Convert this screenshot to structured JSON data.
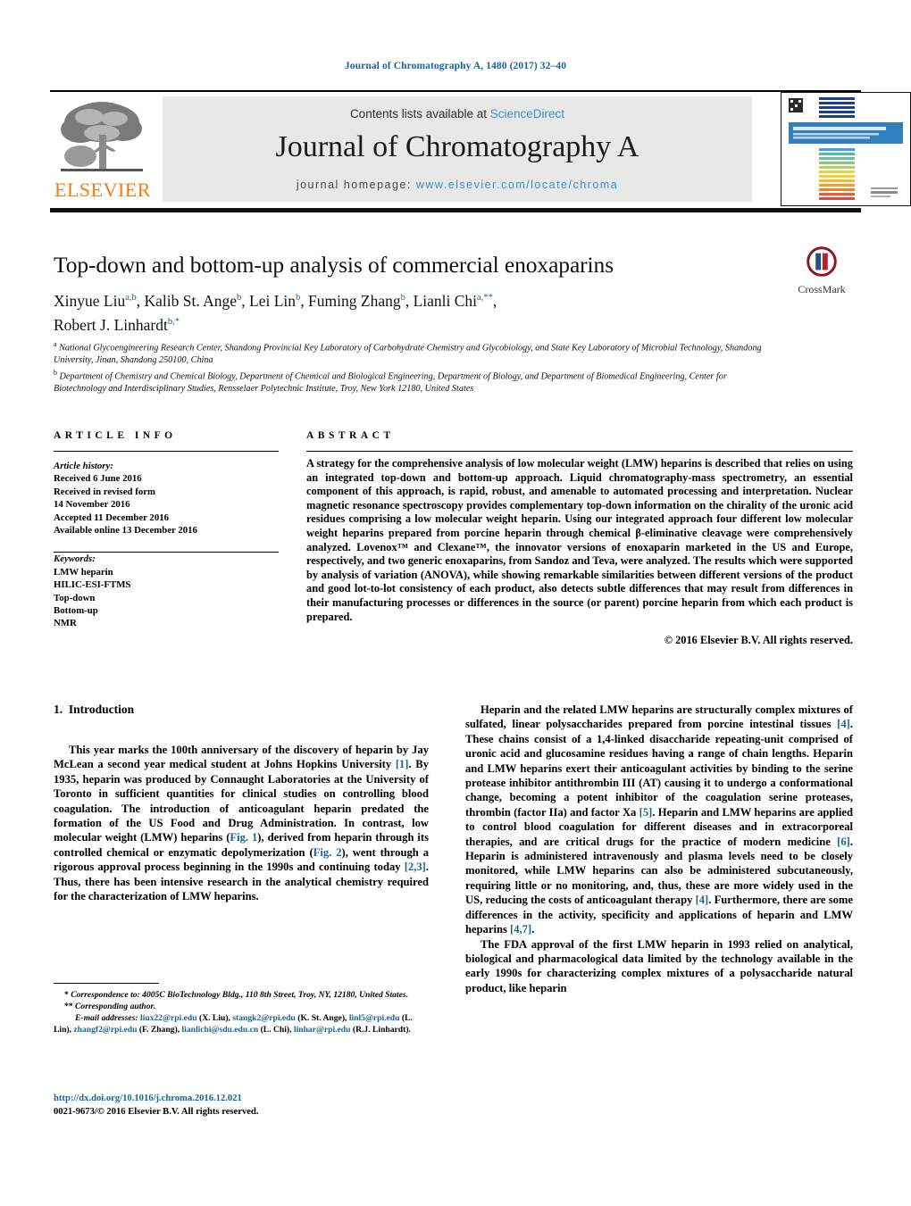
{
  "running_head": "Journal of Chromatography A, 1480 (2017) 32–40",
  "masthead": {
    "publisher": "ELSEVIER",
    "contents_prefix": "Contents lists available at ",
    "contents_link": "ScienceDirect",
    "journal_title": "Journal of Chromatography A",
    "homepage_label": "journal homepage: ",
    "homepage_url": "www.elsevier.com/locate/chroma",
    "cover_title": "JOURNAL OF CHROMATOGRAPHY A",
    "cover_subtitle": "INCLUDING ELECTROPHORESIS AND OTHER SEPARATION METHODS"
  },
  "article": {
    "title": "Top-down and bottom-up analysis of commercial enoxaparins",
    "crossmark_label": "CrossMark",
    "authors_line1_parts": [
      {
        "name": "Xinyue Liu",
        "sup": "a,b"
      },
      {
        "name": "Kalib St. Ange",
        "sup": "b"
      },
      {
        "name": "Lei Lin",
        "sup": "b"
      },
      {
        "name": "Fuming Zhang",
        "sup": "b"
      },
      {
        "name": "Lianli Chi",
        "sup": "a,**"
      }
    ],
    "authors_line2_parts": [
      {
        "name": "Robert J. Linhardt",
        "sup": "b,*"
      }
    ],
    "affiliations": [
      {
        "marker": "a",
        "text": "National Glycoengineering Research Center, Shandong Provincial Key Laboratory of Carbohydrate Chemistry and Glycobiology, and State Key Laboratory of Microbial Technology, Shandong University, Jinan, Shandong 250100, China"
      },
      {
        "marker": "b",
        "text": "Department of Chemistry and Chemical Biology, Department of Chemical and Biological Engineering, Department of Biology, and Department of Biomedical Engineering, Center for Biotechnology and Interdisciplinary Studies, Rensselaer Polytechnic Institute, Troy, New York 12180, United States"
      }
    ]
  },
  "article_info": {
    "label": "ARTICLE INFO",
    "history_heading": "Article history:",
    "history": [
      "Received 6 June 2016",
      "Received in revised form",
      "14 November 2016",
      "Accepted 11 December 2016",
      "Available online 13 December 2016"
    ],
    "keywords_heading": "Keywords:",
    "keywords": [
      "LMW heparin",
      "HILIC-ESI-FTMS",
      "Top-down",
      "Bottom-up",
      "NMR"
    ]
  },
  "abstract": {
    "label": "ABSTRACT",
    "text": "A strategy for the comprehensive analysis of low molecular weight (LMW) heparins is described that relies on using an integrated top-down and bottom-up approach. Liquid chromatography-mass spectrometry, an essential component of this approach, is rapid, robust, and amenable to automated processing and interpretation. Nuclear magnetic resonance spectroscopy provides complementary top-down information on the chirality of the uronic acid residues comprising a low molecular weight heparin. Using our integrated approach four different low molecular weight heparins prepared from porcine heparin through chemical β-eliminative cleavage were comprehensively analyzed. Lovenox™ and Clexane™, the innovator versions of enoxaparin marketed in the US and Europe, respectively, and two generic enoxaparins, from Sandoz and Teva, were analyzed. The results which were supported by analysis of variation (ANOVA), while showing remarkable similarities between different versions of the product and good lot-to-lot consistency of each product, also detects subtle differences that may result from differences in their manufacturing processes or differences in the source (or parent) porcine heparin from which each product is prepared.",
    "copyright": "© 2016 Elsevier B.V. All rights reserved."
  },
  "body": {
    "section_number": "1.",
    "section_title": "Introduction",
    "left_paragraph_1_a": "This year marks the 100th anniversary of the discovery of heparin by Jay McLean a second year medical student at Johns Hopkins University ",
    "left_ref_1": "[1]",
    "left_paragraph_1_b": ". By 1935, heparin was produced by Connaught Laboratories at the University of Toronto in sufficient quantities for clinical studies on controlling blood coagulation. The introduction of anticoagulant heparin predated the formation of the US Food and Drug Administration. In contrast, low molecular weight (LMW) heparins (",
    "left_ref_fig1": "Fig. 1",
    "left_paragraph_1_c": "), derived from heparin through its controlled chemical or enzymatic depolymerization (",
    "left_ref_fig2": "Fig. 2",
    "left_paragraph_1_d": "), went through a rigorous approval process beginning in the 1990s and continuing today ",
    "left_ref_23": "[2,3]",
    "left_paragraph_1_e": ". Thus, there has been intensive research in the analytical chemistry required for the characterization of LMW heparins.",
    "right_paragraph_1_a": "Heparin and the related LMW heparins are structurally complex mixtures of sulfated, linear polysaccharides prepared from porcine intestinal tissues ",
    "right_ref_4": "[4]",
    "right_paragraph_1_b": ". These chains consist of a 1,4-linked disaccharide repeating-unit comprised of uronic acid and glucosamine residues having a range of chain lengths. Heparin and LMW heparins exert their anticoagulant activities by binding to the serine protease inhibitor antithrombin III (AT) causing it to undergo a conformational change, becoming a potent inhibitor of the coagulation serine proteases, thrombin (factor IIa) and factor Xa ",
    "right_ref_5": "[5]",
    "right_paragraph_1_c": ". Heparin and LMW heparins are applied to control blood coagulation for different diseases and in extracorporeal therapies, and are critical drugs for the practice of modern medicine ",
    "right_ref_6": "[6]",
    "right_paragraph_1_d": ". Heparin is administered intravenously and plasma levels need to be closely monitored, while LMW heparins can also be administered subcutaneously, requiring little or no monitoring, and, thus, these are more widely used in the US, reducing the costs of anticoagulant therapy ",
    "right_ref_4b": "[4]",
    "right_paragraph_1_e": ". Furthermore, there are some differences in the activity, specificity and applications of heparin and LMW heparins ",
    "right_ref_47": "[4,7]",
    "right_paragraph_1_f": ".",
    "right_paragraph_2": "The FDA approval of the first LMW heparin in 1993 relied on analytical, biological and pharmacological data limited by the technology available in the early 1990s for characterizing complex mixtures of a polysaccharide natural product, like heparin"
  },
  "footnotes": {
    "correspondence_marker": "*",
    "correspondence_text": "Correspondence to: 4005C BioTechnology Bldg., 110 8th Street, Troy, NY, 12180, United States.",
    "corresponding_marker": "**",
    "corresponding_text": "Corresponding author.",
    "email_label": "E-mail addresses:",
    "emails": [
      {
        "address": "liux22@rpi.edu",
        "person": "(X. Liu)"
      },
      {
        "address": "stangk2@rpi.edu",
        "person": "(K. St. Ange)"
      },
      {
        "address": "linl5@rpi.edu",
        "person": "(L. Lin)"
      },
      {
        "address": "zhangf2@rpi.edu",
        "person": "(F. Zhang)"
      },
      {
        "address": "lianlichi@sdu.edu.cn",
        "person": "(L. Chi)"
      },
      {
        "address": "linhar@rpi.edu",
        "person": "(R.J. Linhardt)"
      }
    ],
    "doi": "http://dx.doi.org/10.1016/j.chroma.2016.12.021",
    "issn_line": "0021-9673/© 2016 Elsevier B.V. All rights reserved."
  },
  "colors": {
    "link": "#1a6496",
    "elsevier_orange": "#f07f13",
    "banner_bg": "#e8e8e8",
    "science_direct": "#3a8fc4"
  }
}
